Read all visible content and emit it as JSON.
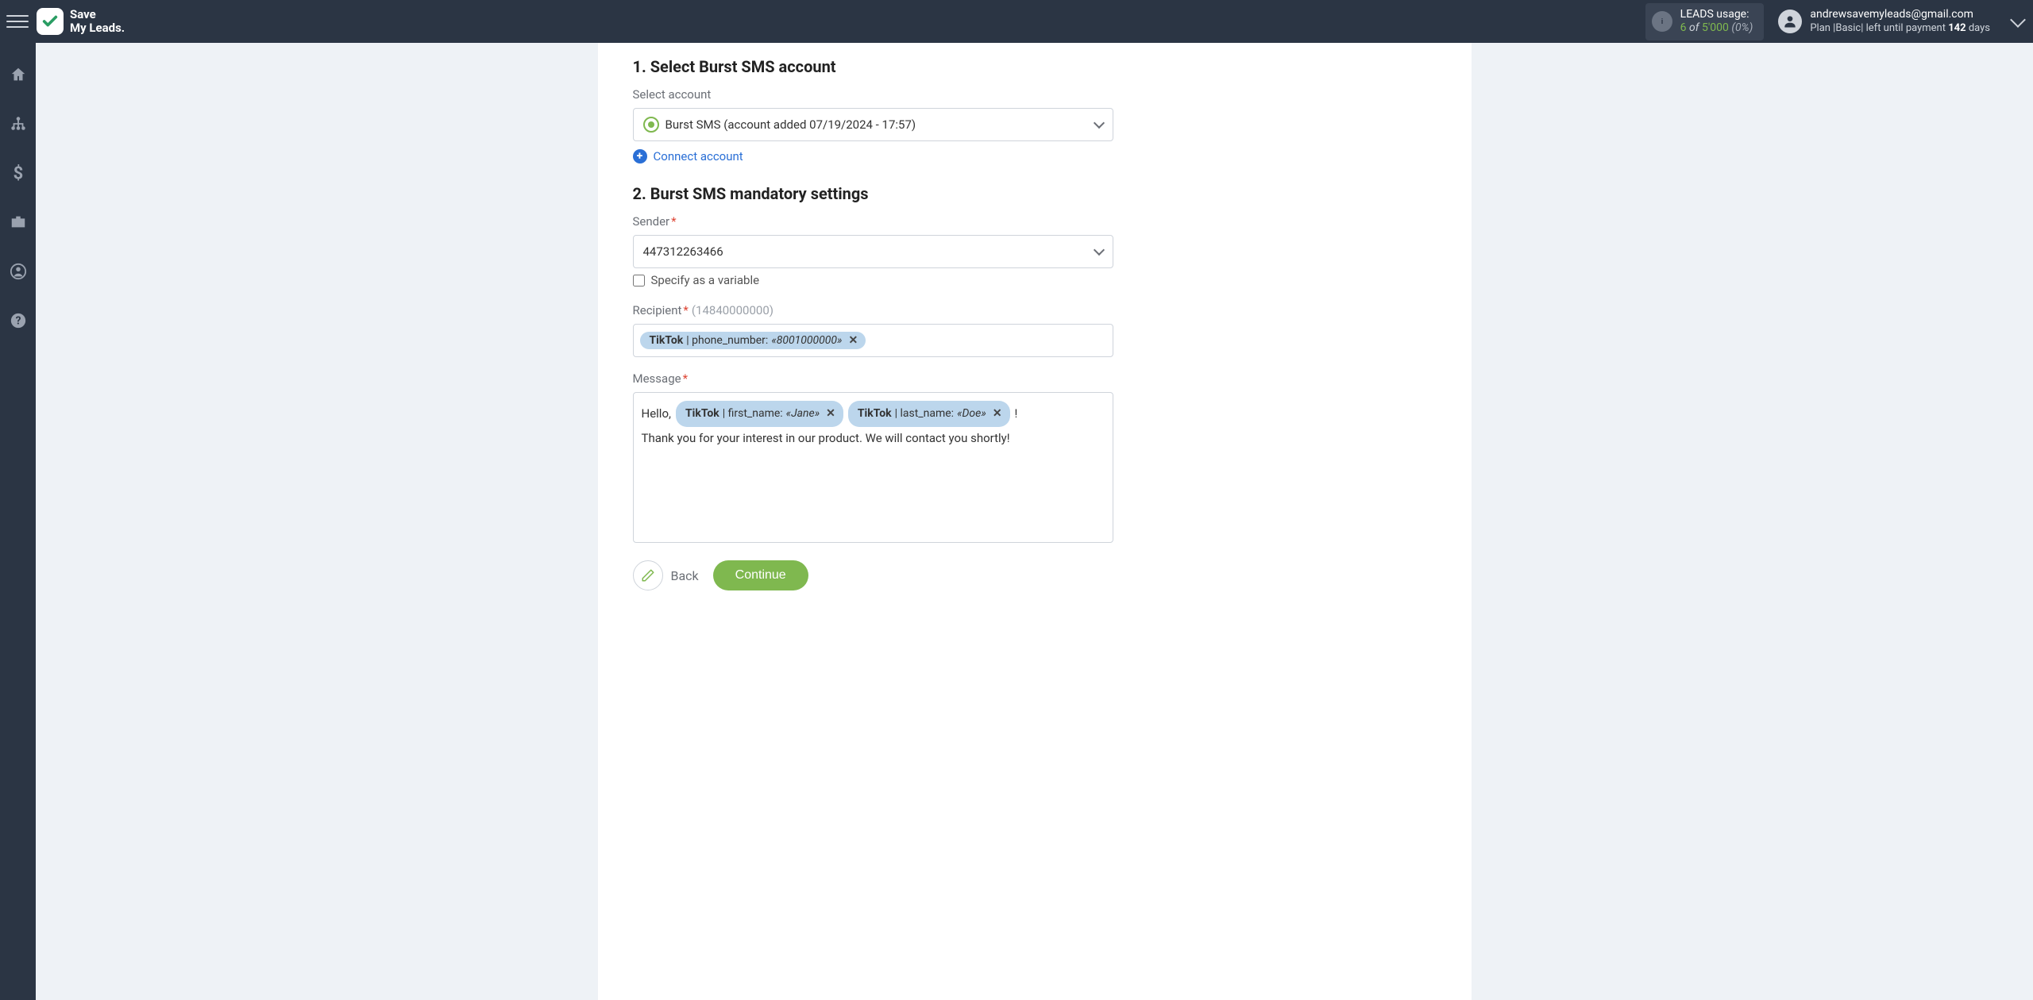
{
  "logo": {
    "line1": "Save",
    "line2": "My Leads."
  },
  "usage": {
    "title": "LEADS usage:",
    "used": "6",
    "of_label": "of",
    "total": "5'000",
    "pct": "(0%)"
  },
  "user": {
    "email": "andrewsavemyleads@gmail.com",
    "plan_prefix": "Plan |",
    "plan_name": "Basic",
    "plan_mid": "| left until payment",
    "days": "142",
    "days_suffix": "days"
  },
  "section1": {
    "prefix": "1. Select ",
    "bold": "Burst SMS",
    "suffix": " account",
    "label": "Select account",
    "value": "Burst SMS (account added 07/19/2024 - 17:57)",
    "connect": "Connect account"
  },
  "section2": {
    "prefix": "2. ",
    "bold": "Burst SMS",
    "suffix": " mandatory settings"
  },
  "sender": {
    "label": "Sender",
    "value": "447312263466",
    "specify": "Specify as a variable"
  },
  "recipient": {
    "label": "Recipient",
    "hint": "(14840000000)",
    "token_source": "TikTok",
    "token_field": " | phone_number: ",
    "token_value": "«8001000000»"
  },
  "message": {
    "label": "Message",
    "hello": "Hello,",
    "excl": "!",
    "t1_source": "TikTok",
    "t1_field": " | first_name: ",
    "t1_value": "«Jane»",
    "t2_source": "TikTok",
    "t2_field": " | last_name: ",
    "t2_value": "«Doe»",
    "line2": "Thank you for your interest in our product. We will contact you shortly!"
  },
  "buttons": {
    "back": "Back",
    "continue": "Continue"
  }
}
